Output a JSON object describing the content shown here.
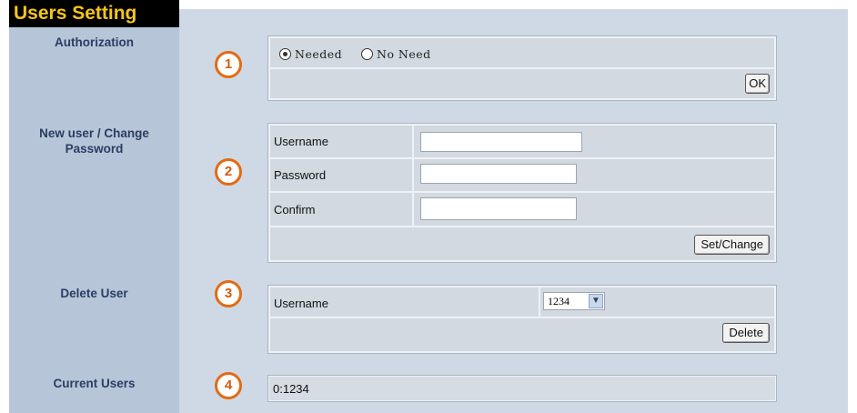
{
  "page": {
    "title": "Users Setting"
  },
  "sidebar": {
    "authorization": "Authorization",
    "new_user": [
      "New user / Change",
      "Password"
    ],
    "delete_user": "Delete User",
    "current_users": "Current Users"
  },
  "badges": [
    "1",
    "2",
    "3",
    "4"
  ],
  "authorization": {
    "options": [
      "Needed",
      "No Need"
    ],
    "selected": "Needed",
    "ok_label": "OK"
  },
  "new_user_form": {
    "username_label": "Username",
    "password_label": "Password",
    "confirm_label": "Confirm",
    "username_value": "",
    "password_value": "",
    "confirm_value": "",
    "submit_label": "Set/Change"
  },
  "delete_form": {
    "username_label": "Username",
    "selected_user": "1234",
    "delete_label": "Delete"
  },
  "current_users": {
    "value": "0:1234"
  },
  "colors": {
    "title_bg": "#000000",
    "title_fg": "#f6c51a",
    "badge": "#e36b12",
    "sidebar_text": "#2a3d63"
  }
}
